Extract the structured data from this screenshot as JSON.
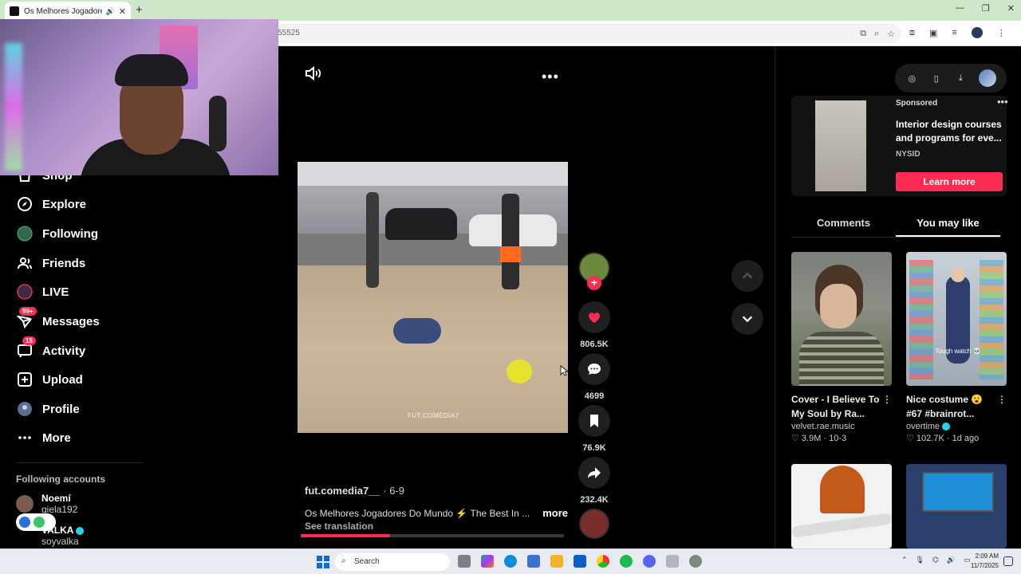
{
  "browser": {
    "tab_title": "Os Melhores Jogadores Do Mundo",
    "url_fragment": "55525"
  },
  "sidebar": {
    "items": [
      {
        "label": "Shop",
        "icon": "shop-icon"
      },
      {
        "label": "Explore",
        "icon": "compass-icon"
      },
      {
        "label": "Following",
        "icon": "following-avatar-icon"
      },
      {
        "label": "Friends",
        "icon": "friends-icon"
      },
      {
        "label": "LIVE",
        "icon": "live-icon"
      },
      {
        "label": "Messages",
        "icon": "messages-icon",
        "badge": "99+"
      },
      {
        "label": "Activity",
        "icon": "activity-icon",
        "badge": "15"
      },
      {
        "label": "Upload",
        "icon": "upload-icon"
      },
      {
        "label": "Profile",
        "icon": "profile-avatar-icon"
      },
      {
        "label": "More",
        "icon": "more-dots-icon"
      }
    ],
    "following_header": "Following accounts",
    "accounts": [
      {
        "name": "Noemí",
        "handle": "giela192"
      },
      {
        "name": "VALKA",
        "handle": "soyvalka",
        "verified": true
      }
    ]
  },
  "video": {
    "watermark": "FUT.COMÉDIA7",
    "author": "fut.comedia7__",
    "date": " · 6-9",
    "title": "Os Melhores Jogadores Do Mundo ⚡ The Best In ...",
    "more_label": "more",
    "see_translation": "See translation",
    "progress": 0.34,
    "likes": "806.5K",
    "comments": "4699",
    "saves": "76.9K",
    "shares": "232.4K"
  },
  "ad": {
    "sponsored": "Sponsored",
    "title": "Interior design courses and programs for eve...",
    "source": "NYSID",
    "cta": "Learn more"
  },
  "right_tabs": [
    {
      "label": "Comments",
      "active": false
    },
    {
      "label": "You may like",
      "active": true
    }
  ],
  "recommendations": [
    {
      "title": "Cover - I Believe To My Soul by Ra...",
      "author": "velvet.rae.music",
      "likes": "3.9M",
      "date": "10-3",
      "verified": false
    },
    {
      "title": "Nice costume 😮 #67 #brainrot...",
      "author": "overtime",
      "likes": "102.7K",
      "date": "1d ago",
      "verified": true,
      "overlay_text": "Tough watch 💀"
    }
  ],
  "taskbar": {
    "search_label": "Search",
    "time": "2:09 AM",
    "date": "11/7/2025"
  },
  "colors": {
    "accent": "#fe2c55",
    "verified": "#20d5ec",
    "chrome_tabbar": "#cfe8c9"
  }
}
